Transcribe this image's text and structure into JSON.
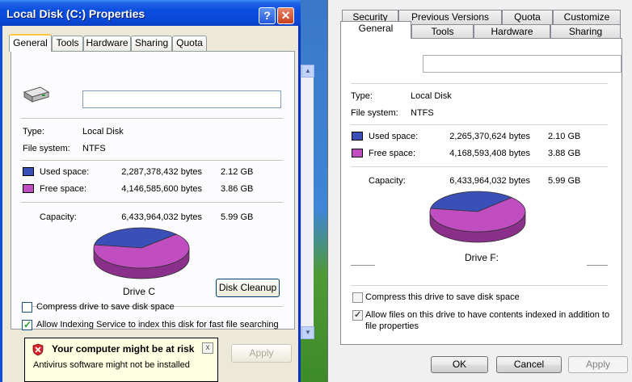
{
  "left_window": {
    "title": "Local Disk (C:) Properties",
    "help_label": "?",
    "close_label": "✕",
    "tabs": [
      "General",
      "Tools",
      "Hardware",
      "Sharing",
      "Quota"
    ],
    "label_value": "",
    "type_label": "Type:",
    "type_value": "Local Disk",
    "fs_label": "File system:",
    "fs_value": "NTFS",
    "used_label": "Used space:",
    "used_bytes": "2,287,378,432 bytes",
    "used_gb": "2.12 GB",
    "free_label": "Free space:",
    "free_bytes": "4,146,585,600 bytes",
    "free_gb": "3.86 GB",
    "capacity_label": "Capacity:",
    "capacity_bytes": "6,433,964,032 bytes",
    "capacity_gb": "5.99 GB",
    "drive_label": "Drive C",
    "cleanup_button": "Disk Cleanup",
    "compress_label": "Compress drive to save disk space",
    "compress_checked": false,
    "index_label": "Allow Indexing Service to index this disk for fast file searching",
    "index_checked": true,
    "apply_button": "Apply",
    "used_fraction": 0.3555,
    "colors": {
      "used": "#3b4fb8",
      "free": "#c04ec0"
    }
  },
  "balloon": {
    "title": "Your computer might be at risk",
    "message": "Antivirus software might not be installed",
    "close_label": "x"
  },
  "right_window": {
    "tabs_back": [
      "Security",
      "Previous Versions",
      "Quota",
      "Customize"
    ],
    "tabs_front": [
      "General",
      "Tools",
      "Hardware",
      "Sharing"
    ],
    "label_value": "",
    "type_label": "Type:",
    "type_value": "Local Disk",
    "fs_label": "File system:",
    "fs_value": "NTFS",
    "used_label": "Used space:",
    "used_bytes": "2,265,370,624 bytes",
    "used_gb": "2.10 GB",
    "free_label": "Free space:",
    "free_bytes": "4,168,593,408 bytes",
    "free_gb": "3.88 GB",
    "capacity_label": "Capacity:",
    "capacity_bytes": "6,433,964,032 bytes",
    "capacity_gb": "5.99 GB",
    "drive_label": "Drive F:",
    "compress_label": "Compress this drive to save disk space",
    "compress_checked": false,
    "index_label_line1": "Allow files on this drive to have contents indexed in addition to",
    "index_label_line2": "file properties",
    "index_checked": true,
    "ok_button": "OK",
    "cancel_button": "Cancel",
    "apply_button": "Apply",
    "used_fraction": 0.3521,
    "colors": {
      "used": "#3b4fb8",
      "free": "#c04ec0"
    }
  }
}
